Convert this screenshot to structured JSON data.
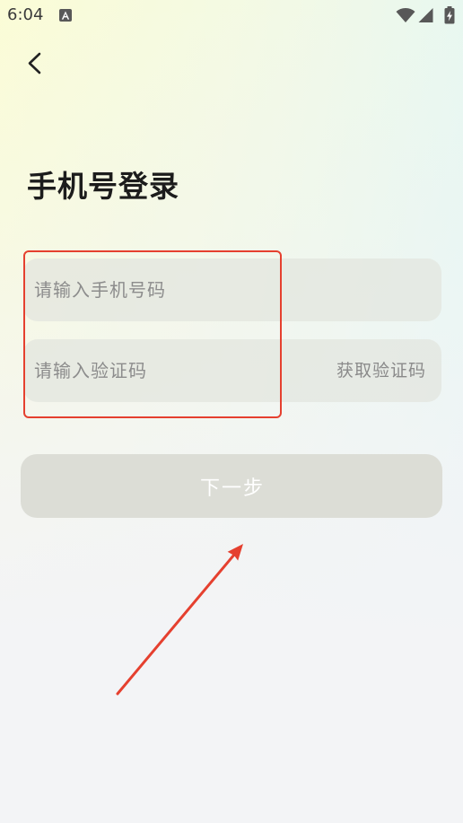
{
  "status_bar": {
    "time": "6:04",
    "icons": [
      "notification-a-icon",
      "wifi-icon",
      "signal-icon",
      "battery-charging-icon"
    ]
  },
  "header": {
    "back_icon": "chevron-left-icon"
  },
  "login": {
    "title": "手机号登录",
    "phone_value": "",
    "phone_placeholder": "请输入手机号码",
    "code_value": "",
    "code_placeholder": "请输入验证码",
    "get_code_label": "获取验证码",
    "next_label": "下一步",
    "next_disabled": true
  },
  "colors": {
    "annotation": "#e5402f",
    "button_bg": "#dcddd6",
    "title_text": "#1c1c1c",
    "placeholder_text": "#8c8c8c"
  }
}
